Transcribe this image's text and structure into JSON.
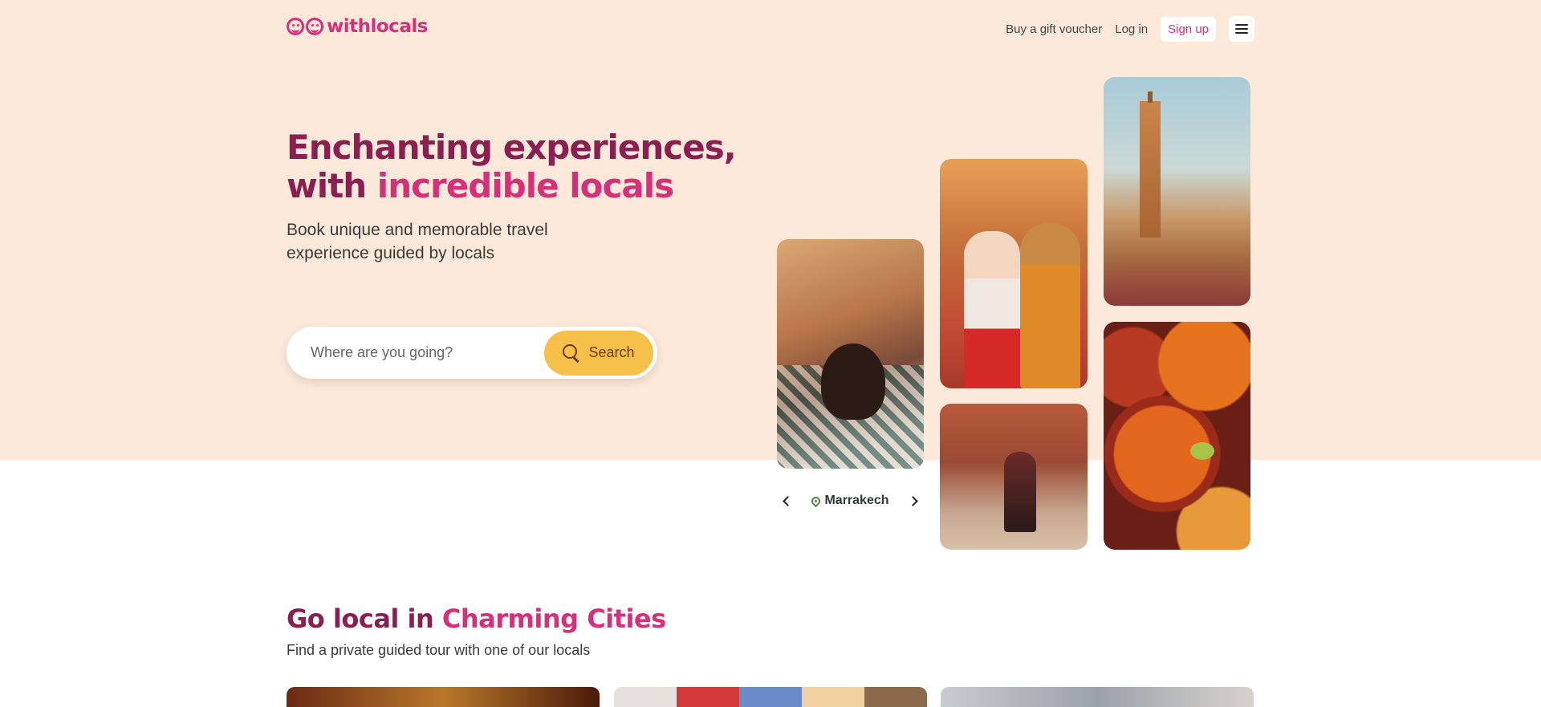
{
  "header": {
    "logo_text": "withlocals",
    "nav": {
      "gift_voucher": "Buy a gift voucher",
      "login": "Log in",
      "signup": "Sign up"
    }
  },
  "hero": {
    "title_line1": "Enchanting experiences,",
    "title_line2_prefix": "with ",
    "title_line2_accent": "incredible locals",
    "subtitle": "Book unique and memorable travel experience guided by locals",
    "search": {
      "placeholder": "Where are you going?",
      "button_label": "Search"
    },
    "city_carousel": {
      "current_city": "Marrakech"
    }
  },
  "section": {
    "title_prefix": "Go local in ",
    "title_accent": "Charming Cities",
    "subtitle": "Find a private guided tour with one of our locals"
  },
  "colors": {
    "hero_bg": "#fde9d9",
    "brand_dark": "#8b1e52",
    "brand_pink": "#d6307a",
    "search_button": "#f6c04b",
    "pin_green": "#4c8a3a"
  },
  "icons": [
    "logo-icon",
    "search-icon",
    "menu-icon",
    "chevron-left-icon",
    "chevron-right-icon",
    "map-pin-icon"
  ]
}
